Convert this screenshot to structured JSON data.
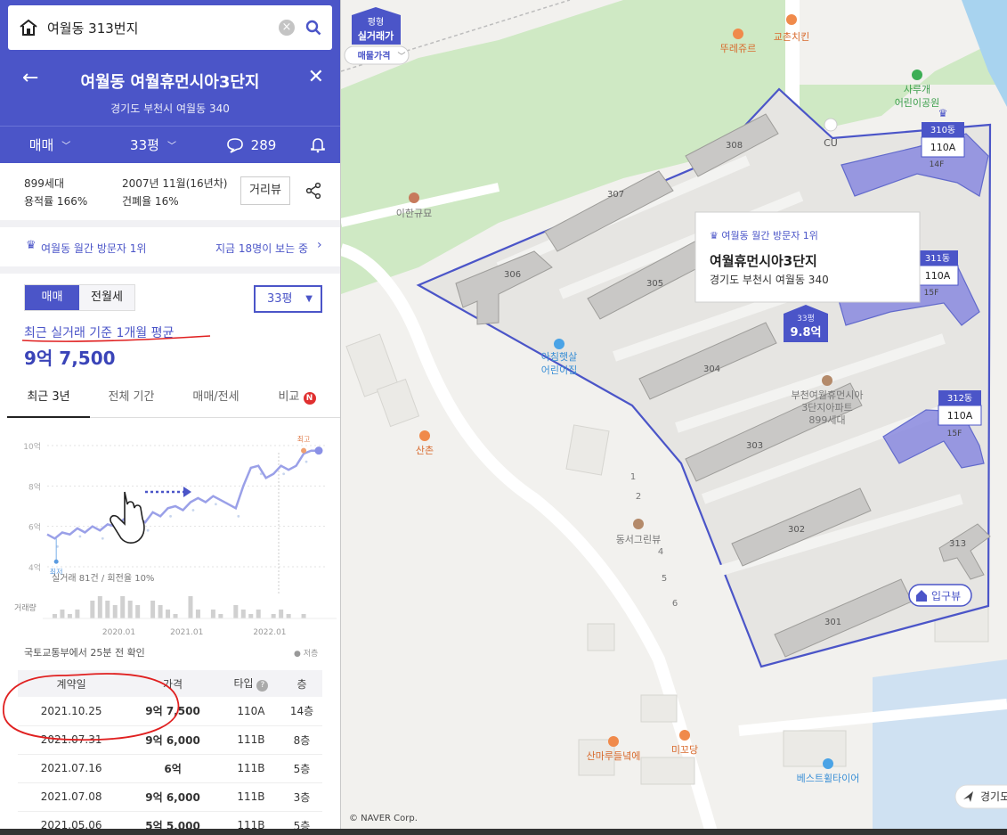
{
  "search": {
    "value": "여월동 313번지"
  },
  "header": {
    "title": "여월동 여월휴먼시아3단지",
    "address": "경기도 부천시 여월동 340"
  },
  "options": {
    "trade": "매매",
    "size": "33평",
    "comments": "289"
  },
  "info": {
    "households": "899세대",
    "far": "용적률 166%",
    "built": "2007년 11월(16년차)",
    "bcr": "건폐율 16%",
    "street_view": "거리뷰"
  },
  "visitor": {
    "rank": "여월동 월간 방문자 1위",
    "now": "지금 18명이 보는 중"
  },
  "segment": {
    "sale": "매매",
    "rent": "전월세",
    "size": "33평"
  },
  "summary": {
    "basis": "최근 실거래 기준 1개월 평균",
    "price": "9억 7,500"
  },
  "tabs": [
    "최근 3년",
    "전체 기간",
    "매매/전세",
    "비교"
  ],
  "tab_badge": "N",
  "chart_data": {
    "type": "line",
    "ytick_labels": [
      "10억",
      "8억",
      "6억",
      "4억"
    ],
    "y_ticks": [
      10,
      8,
      6,
      4
    ],
    "ylim": [
      4,
      10
    ],
    "xtick_labels": [
      "2020.01",
      "2021.01",
      "2022.01"
    ],
    "series": [
      {
        "name": "실거래",
        "t": [
          0,
          1,
          2,
          3,
          4,
          5,
          6,
          7,
          8,
          9,
          10,
          11,
          12,
          13,
          14,
          15,
          16,
          17,
          18,
          19,
          20,
          21,
          22,
          23,
          24,
          25,
          26,
          27,
          28,
          29,
          30,
          31,
          32,
          33,
          34,
          35,
          36
        ],
        "values": [
          5.6,
          5.4,
          5.7,
          5.6,
          5.9,
          5.7,
          6.0,
          5.8,
          6.1,
          6.0,
          6.3,
          6.6,
          6.4,
          6.2,
          6.7,
          6.5,
          6.9,
          7.0,
          6.8,
          7.2,
          7.4,
          7.2,
          7.5,
          7.3,
          7.1,
          6.9,
          8.0,
          8.9,
          9.0,
          8.4,
          8.6,
          9.0,
          8.8,
          9.0,
          9.6,
          9.75,
          9.75
        ]
      }
    ],
    "high_label": "최고",
    "low_label": "최저",
    "stats": "실거래 81건 / 회전율 10%",
    "volume_label": "거래량",
    "volume": [
      0,
      1,
      2,
      1,
      2,
      0,
      4,
      5,
      4,
      3,
      5,
      4,
      3,
      0,
      4,
      3,
      2,
      1,
      0,
      5,
      2,
      0,
      2,
      1,
      0,
      3,
      2,
      1,
      2,
      0,
      1,
      2,
      1,
      0,
      1,
      0,
      0
    ]
  },
  "source": "국토교통부에서 25분 전 확인",
  "layer_label": "저층",
  "table": {
    "headers": [
      "계약일",
      "가격",
      "타입",
      "층"
    ],
    "rows": [
      [
        "2021.10.25",
        "9억 7,500",
        "110A",
        "14층"
      ],
      [
        "2021.07.31",
        "9억 6,000",
        "111B",
        "8층"
      ],
      [
        "2021.07.16",
        "6억",
        "111B",
        "5층"
      ],
      [
        "2021.07.08",
        "9억 6,000",
        "111B",
        "3층"
      ],
      [
        "2021.05.06",
        "5억 5,000",
        "111B",
        "5층"
      ]
    ]
  },
  "map": {
    "chip_line1": "평형",
    "chip_line2": "실거래가",
    "chip_sub": "매물가격",
    "popup": {
      "rank": "여월동 월간 방문자 1위",
      "name": "여월휴먼시아3단지",
      "addr": "경기도 부천시 여월동 340"
    },
    "marker": {
      "size": "33평",
      "price": "9.8억"
    },
    "dong_tags": [
      {
        "name": "310동",
        "type": "110A",
        "floor": "14F"
      },
      {
        "name": "311동",
        "type": "110A",
        "floor": "15F"
      },
      {
        "name": "312동",
        "type": "110A",
        "floor": "15F"
      }
    ],
    "buildings": [
      "308",
      "307",
      "306",
      "305",
      "304",
      "303",
      "302",
      "301",
      "313"
    ],
    "pois": [
      "뚜레쥬르",
      "교촌치킨",
      "CU",
      "사루개",
      "어린이공원",
      "이한규묘",
      "아침햇살",
      "어린이집",
      "산촌",
      "부천여월휴먼시아",
      "3단지아파트",
      "899세대",
      "동서그린뷰",
      "산마루들녘에",
      "미꼬당",
      "베스트휠타이어"
    ],
    "numbers": [
      "1",
      "2",
      "4",
      "5",
      "6"
    ],
    "entrance": "입구뷰",
    "copyright": "© NAVER Corp.",
    "nav": "경기도"
  }
}
